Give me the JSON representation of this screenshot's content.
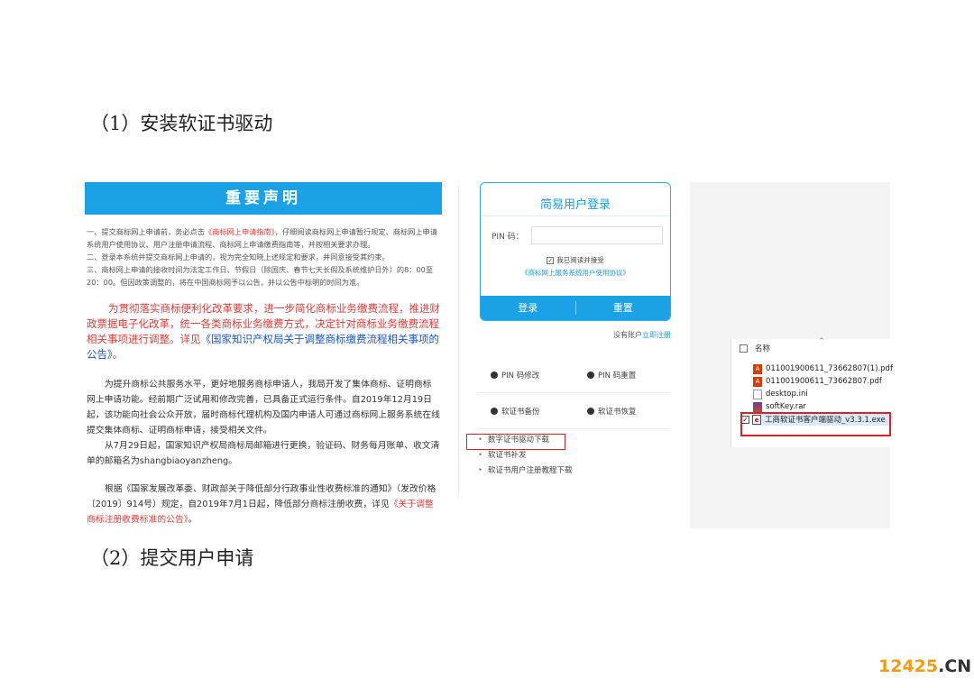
{
  "headings": {
    "step1": "（1）安装软证书驱动",
    "step2": "（2）提交用户申请"
  },
  "notice": {
    "banner": "重要声明",
    "small_1a": "一、提交商标网上申请前，务必点击",
    "small_1_link": "《商标网上申请指南》",
    "small_1b": "，仔细阅读商标网上申请暂行规定、商标网上申请系统用户使用协议、用户注册申请流程、商标网上申请缴费指南等，并按相关要求办理。",
    "small_2": "二、登录本系统并提交商标网上申请的，视为完全知晓上述规定和要求，并同意接受其约束。",
    "small_3": "三、商标网上申请的接收时间为法定工作日、节假日（除国庆、春节七天长假及系统维护日外）的8：00至20：00。但因政策调整的，将在中国商标网予以公告，并以公告中标明的时间为准。",
    "big_a": "为贯彻落实商标便利化改革要求，进一步简化商标业务缴费流程，推进财政票据电子化改革，统一各类商标业务缴费方式，决定针对商标业务缴费流程相关事项进行调整。详见",
    "big_link": "《国家知识产权局关于调整商标缴费流程相关事项的公告》",
    "big_b": "。",
    "body_1": "为提升商标公共服务水平，更好地服务商标申请人，我局开发了集体商标、证明商标网上申请功能。经前期广泛试用和修改完善，已具备正式运行条件。自2019年12月19日起，该功能向社会公众开放，届时商标代理机构及国内申请人可通过商标网上服务系统在线提交集体商标、证明商标申请，接受相关文件。",
    "body_2": "从7月29日起，国家知识产权局商标局邮箱进行更换，验证码、财务每月账单、收文清单的邮箱名为shangbiaoyanzheng。",
    "body_3a": "根据《国家发展改革委、财政部关于降低部分行政事业性收费标准的通知》（发改价格〔2019〕914号）规定，自2019年7月1日起，降低部分商标注册收费，详见",
    "body_3_link": "《关于调整商标注册收费标准的公告》",
    "body_3b": "。"
  },
  "login": {
    "title": "简易用户登录",
    "pin_label": "PIN 码：",
    "pin_value": "",
    "agree_label": "我已阅读并接受",
    "agree_link": "《商标网上服务系统用户使用协议》",
    "login_button": "登录",
    "reset_button": "重置",
    "no_account": "没有账户",
    "register_link": "立即注册"
  },
  "tools": {
    "pin_modify": "PIN 码修改",
    "pin_reset": "PIN 码重置",
    "cert_backup": "软证书备份",
    "cert_restore": "软证书恢复"
  },
  "downloads": {
    "driver": "数字证书驱动下载",
    "reissue": "软证书补发",
    "tutorial": "软证书用户注册教程下载"
  },
  "explorer": {
    "column_name": "名称",
    "files": [
      "011001900611_73662807(1).pdf",
      "011001900611_73662807.pdf",
      "desktop.ini",
      "softKey.rar",
      "工商软证书客户端驱动_v3.3.1.exe"
    ]
  },
  "watermark": {
    "number": "12425",
    "suffix": ".CN"
  }
}
